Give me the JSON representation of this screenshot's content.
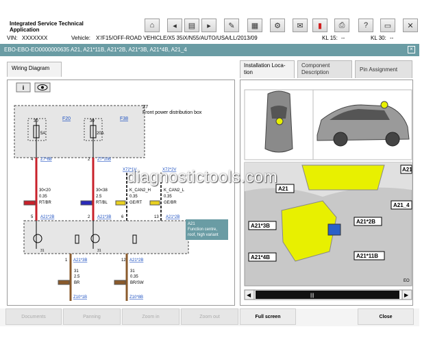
{
  "app": {
    "title": "Integrated Service Technical Application"
  },
  "toolbar": {
    "icons": [
      "home-icon",
      "back-icon",
      "document-icon",
      "forward-icon",
      "wrench-icon",
      "info-grid-icon",
      "vehicle-tools-icon",
      "mail-icon",
      "battery-icon",
      "print-icon",
      "help-icon",
      "display-icon",
      "close-icon"
    ]
  },
  "vehicle": {
    "vin_label": "VIN:",
    "vin_value": "XXXXXXX",
    "vehicle_label": "Vehicle:",
    "vehicle_value": "X'/F15/OFF-ROAD VEHICLE/X5 35iX/N55/AUTO/USA/LL/2013/09",
    "kl15_label": "KL 15:",
    "kl15_value": "--",
    "kl30_label": "KL 30:",
    "kl30_value": "--"
  },
  "window": {
    "title": "EBO-EBO-EO0000000635 A21, A21*11B, A21*2B, A21*3B, A21*4B, A21_4",
    "close": "×"
  },
  "tabs": {
    "wiring": "Wiring Diagram",
    "install_1": "Installation Loca-",
    "install_2": "tion",
    "component_1": "Component",
    "component_2": "Description",
    "pin": "Pin Assignment"
  },
  "wiring": {
    "info_btn": "i",
    "z7": "Z7",
    "z7_desc": "Front power distribution box",
    "f20": "F20",
    "f38": "F38",
    "fuse1_top": "30",
    "fuse1_amp": "5A",
    "fuse2_top": "30",
    "fuse2_amp": "20A",
    "pin4": "4",
    "pin2": "2",
    "z7_6b": "Z7*6B",
    "z7_10b": "Z7*10B",
    "w1_a": "30<20",
    "w1_b": "0.35",
    "w1_c": "RT/BR",
    "w2_a": "30<38",
    "w2_b": "2.5",
    "w2_c": "RT/BL",
    "x72_1v": "X72*1V",
    "x72_2v": "X72*2V",
    "can_h": "K_CAN2_H",
    "can_h_b": "0.35",
    "can_h_c": "GE/RT",
    "can_l": "K_CAN2_L",
    "can_l_b": "0.35",
    "can_l_c": "GE/BR",
    "a21_pin5": "5",
    "a21_pin2": "2",
    "a21_pin6": "6",
    "a21_pin13": "13",
    "a21_2b_1": "A21*2B",
    "a21_3b": "A21*3B",
    "a21_2b_2": "A21*2B",
    "a21_box_1": "A21",
    "a21_box_2": "Function centre,",
    "a21_box_3": "roof, high variant",
    "a21_box_tail": "tre",
    "pin31a": "31",
    "pin31b": "31",
    "bot_pin1": "1",
    "bot_pin12": "12",
    "a21_3b_b": "A21*3B",
    "a21_2b_b": "A21*2B",
    "g1_a": "31",
    "g1_b": "2.5",
    "g1_c": "BR",
    "g2_a": "31",
    "g2_b": "0.35",
    "g2_c": "BR/SW",
    "z10_1": "Z10*1B",
    "z10_2": "Z10*8B"
  },
  "install": {
    "a21_top": "A21",
    "a21": "A21",
    "a21_3b": "A21*3B",
    "a21_2b": "A21*2B",
    "a21_4b": "A21*4B",
    "a21_11b": "A21*11B",
    "a21_4": "A21_4",
    "eo": "EO",
    "scroll_left": "◀",
    "scroll_right": "▶",
    "scroll_grip": "|||"
  },
  "bottom": {
    "documents": "Documents",
    "panning": "Panning",
    "zoom_in": "Zoom in",
    "zoom_out": "Zoom out",
    "full_screen": "Full screen",
    "close": "Close"
  },
  "watermark": "diagnostictools.com",
  "colors": {
    "header": "#6a9ca4",
    "wire_red": "#c8202a",
    "wire_brown": "#8a5a2b",
    "highlight": "#e8f000"
  }
}
